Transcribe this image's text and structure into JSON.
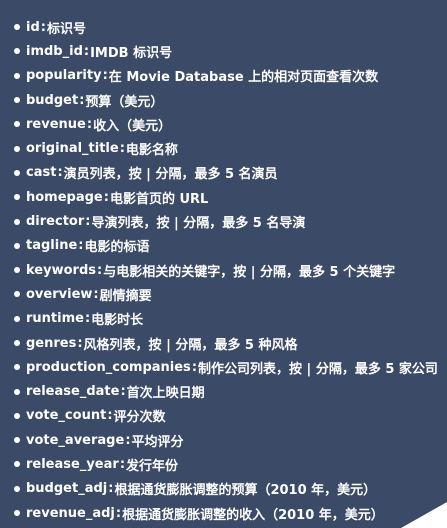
{
  "separator": " : ",
  "fields": [
    {
      "name": "id",
      "desc": "标识号"
    },
    {
      "name": "imdb_id",
      "desc": "IMDB 标识号"
    },
    {
      "name": "popularity",
      "desc": "在 Movie Database 上的相对页面查看次数"
    },
    {
      "name": "budget",
      "desc": "预算（美元）"
    },
    {
      "name": "revenue",
      "desc": "收入（美元）"
    },
    {
      "name": "original_title",
      "desc": "电影名称"
    },
    {
      "name": "cast",
      "desc": "演员列表，按 | 分隔，最多 5 名演员"
    },
    {
      "name": "homepage",
      "desc": "电影首页的 URL"
    },
    {
      "name": "director",
      "desc": "导演列表，按 | 分隔，最多 5 名导演"
    },
    {
      "name": "tagline",
      "desc": "电影的标语"
    },
    {
      "name": "keywords",
      "desc": "与电影相关的关键字，按 | 分隔，最多 5 个关键字"
    },
    {
      "name": "overview",
      "desc": "剧情摘要"
    },
    {
      "name": "runtime",
      "desc": "电影时长"
    },
    {
      "name": "genres",
      "desc": "风格列表，按 | 分隔，最多 5 种风格"
    },
    {
      "name": "production_companies",
      "desc": "制作公司列表，按 | 分隔，最多 5 家公司"
    },
    {
      "name": "release_date",
      "desc": "首次上映日期"
    },
    {
      "name": "vote_count",
      "desc": "评分次数"
    },
    {
      "name": "vote_average",
      "desc": "平均评分"
    },
    {
      "name": "release_year",
      "desc": "发行年份"
    },
    {
      "name": "budget_adj",
      "desc": "根据通货膨胀调整的预算（2010 年，美元）"
    },
    {
      "name": "revenue_adj",
      "desc": "根据通货膨胀调整的收入（2010 年，美元）"
    }
  ]
}
